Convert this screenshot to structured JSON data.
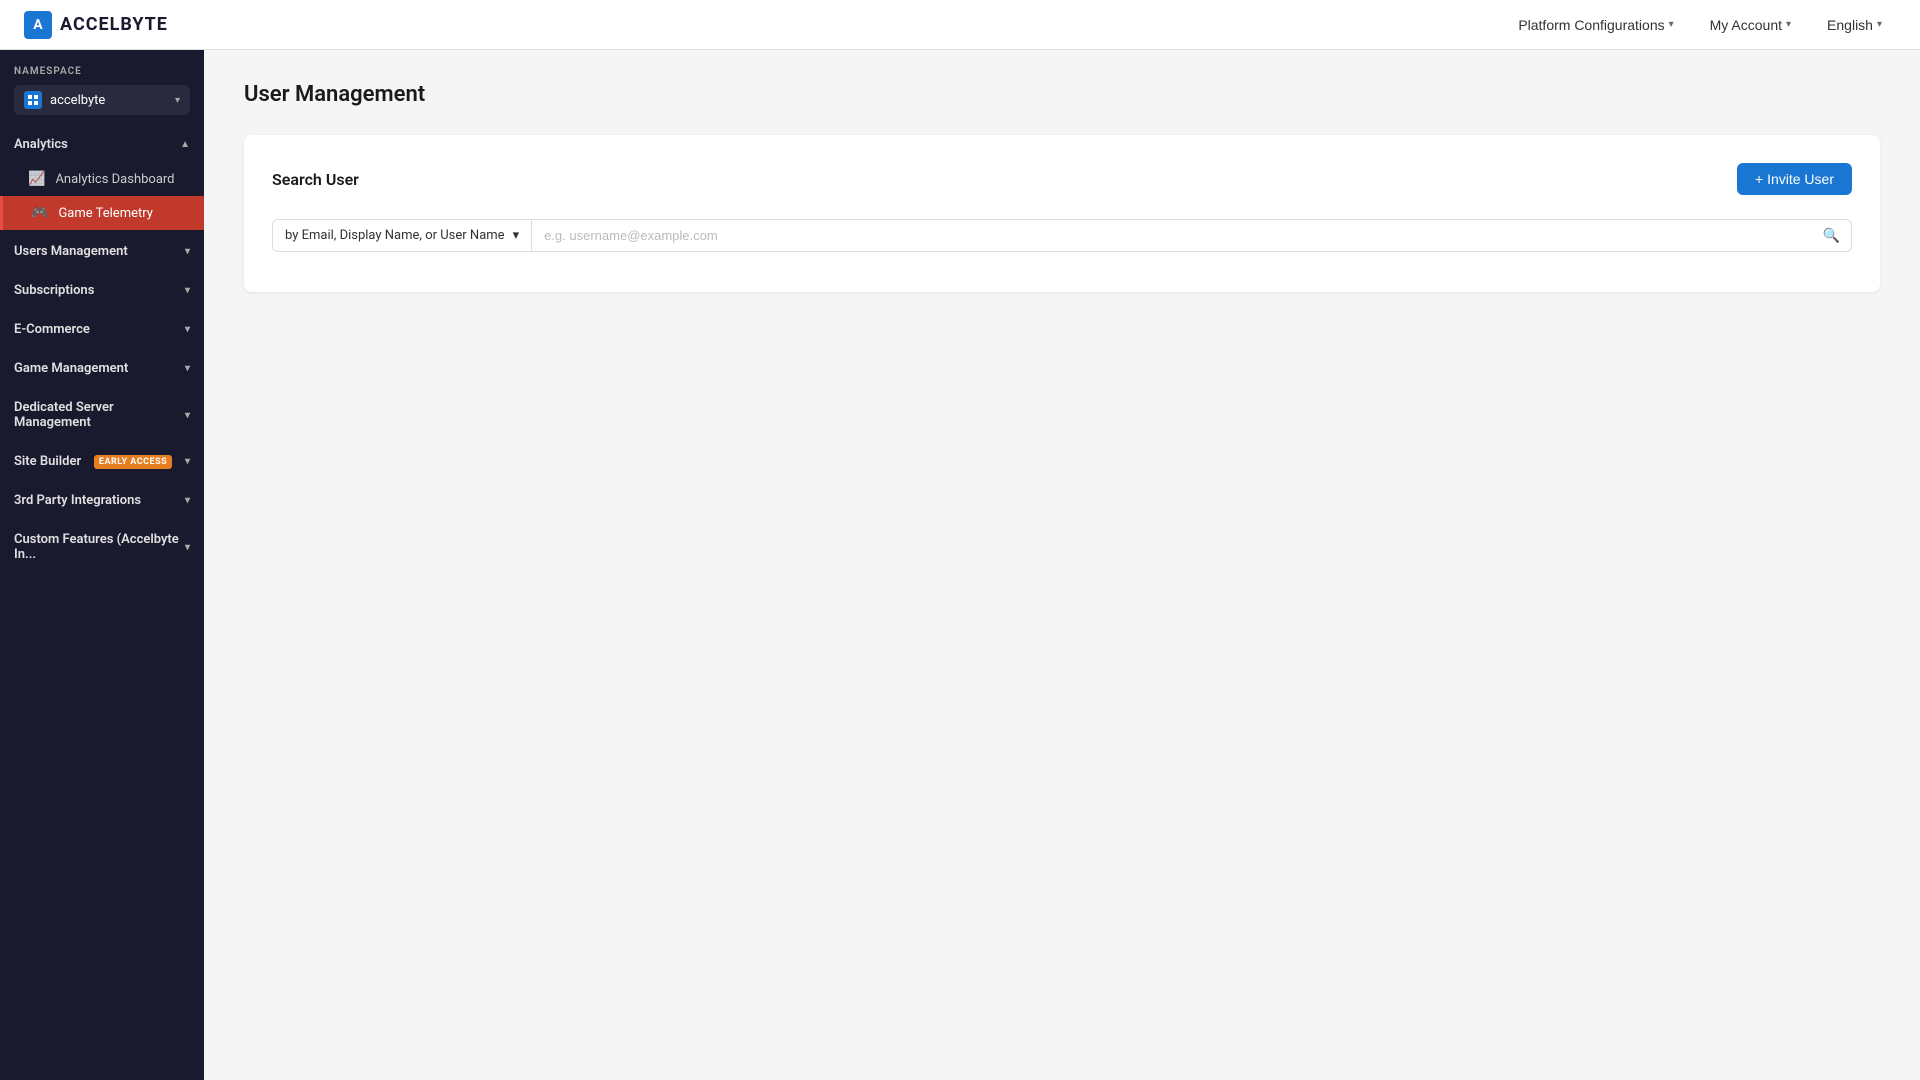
{
  "topNav": {
    "logoText": "ACCELBYTE",
    "logoInitial": "A",
    "platformConfigurations": {
      "label": "Platform Configurations",
      "chevron": "▾"
    },
    "myAccount": {
      "label": "My Account",
      "chevron": "▾"
    },
    "language": {
      "label": "English",
      "chevron": "▾"
    }
  },
  "sidebar": {
    "namespaceLabel": "NAMESPACE",
    "namespaceValue": "accelbyte",
    "sections": [
      {
        "id": "analytics",
        "label": "Analytics",
        "expanded": true,
        "items": [
          {
            "id": "analytics-dashboard",
            "label": "Analytics Dashboard",
            "icon": "📈",
            "active": false
          },
          {
            "id": "game-telemetry",
            "label": "Game Telemetry",
            "icon": "🎮",
            "active": true
          }
        ]
      },
      {
        "id": "users-management",
        "label": "Users Management",
        "expanded": false,
        "items": []
      },
      {
        "id": "subscriptions",
        "label": "Subscriptions",
        "expanded": false,
        "items": []
      },
      {
        "id": "e-commerce",
        "label": "E-Commerce",
        "expanded": false,
        "items": []
      },
      {
        "id": "game-management",
        "label": "Game Management",
        "expanded": false,
        "items": []
      },
      {
        "id": "dedicated-server",
        "label": "Dedicated Server Management",
        "expanded": false,
        "items": []
      },
      {
        "id": "site-builder",
        "label": "Site Builder",
        "badge": "EARLY ACCESS",
        "expanded": false,
        "items": []
      },
      {
        "id": "3rd-party",
        "label": "3rd Party Integrations",
        "expanded": false,
        "items": []
      },
      {
        "id": "custom-features",
        "label": "Custom Features (Accelbyte In...",
        "expanded": false,
        "items": []
      }
    ]
  },
  "mainContent": {
    "pageTitle": "User Management",
    "searchCard": {
      "title": "Search User",
      "inviteButton": "+ Invite User",
      "filterLabel": "by Email, Display Name, or User Name",
      "searchPlaceholder": "e.g. username@example.com"
    }
  }
}
